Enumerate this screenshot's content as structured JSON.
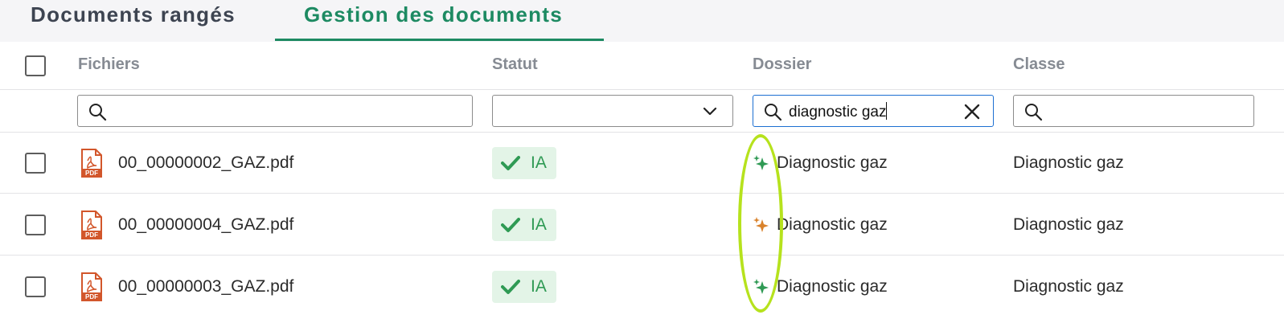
{
  "tabs": [
    {
      "label": "Documents rangés",
      "active": false
    },
    {
      "label": "Gestion des documents",
      "active": true
    }
  ],
  "table": {
    "columns": [
      "Fichiers",
      "Statut",
      "Dossier",
      "Classe"
    ],
    "filters": {
      "fichiers": {
        "value": ""
      },
      "statut": {
        "value": ""
      },
      "dossier": {
        "value": "diagnostic gaz"
      },
      "classe": {
        "value": ""
      }
    },
    "rows": [
      {
        "file": "00_00000002_GAZ.pdf",
        "status": "IA",
        "dossier": "Diagnostic gaz",
        "classe": "Diagnostic gaz",
        "sparkle_color": "#2f9a54"
      },
      {
        "file": "00_00000004_GAZ.pdf",
        "status": "IA",
        "dossier": "Diagnostic gaz",
        "classe": "Diagnostic gaz",
        "sparkle_color": "#d9822b"
      },
      {
        "file": "00_00000003_GAZ.pdf",
        "status": "IA",
        "dossier": "Diagnostic gaz",
        "classe": "Diagnostic gaz",
        "sparkle_color": "#2f9a54"
      }
    ]
  },
  "colors": {
    "accent": "#1d8a62",
    "status_bg": "#e3f4e7",
    "status_text": "#2f9a54",
    "pdf": "#d2562b",
    "highlight": "#b6e21d",
    "focus": "#1c6fd1"
  },
  "icons": {
    "pdf": "pdf-file-icon",
    "status": "check-icon",
    "search": "search-icon",
    "clear": "close-icon",
    "dropdown": "chevron-down-icon",
    "ai": "sparkle-icon"
  }
}
